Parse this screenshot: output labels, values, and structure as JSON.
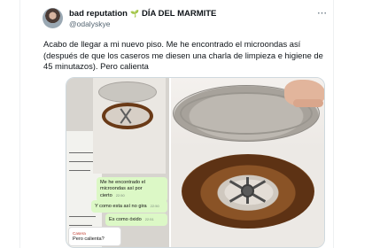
{
  "tweet": {
    "display_name": "bad reputation",
    "name_suffix": "DÍA DEL MARMITE",
    "handle": "@odalyskye",
    "text": "Acabo de llegar a mi nuevo piso. Me he encontrado el microondas así (después de que los caseros me diesen una charla de limpieza e higiene de 45 minutazos). Pero calienta"
  },
  "chat": {
    "messages": [
      {
        "text": "Me he encontrado el microondas así por cierto",
        "time": "22:50"
      },
      {
        "text": "Y como esta así no gira",
        "time": "22:50"
      },
      {
        "text": "Es como óxido",
        "time": "22:51"
      }
    ],
    "reply": {
      "sender": "Casera",
      "text": "Pero calienta?"
    }
  },
  "icons": {
    "leaf": "plant-leaf-icon",
    "more": "more-options-icon"
  },
  "colors": {
    "text_primary": "#0f1419",
    "text_secondary": "#536471",
    "chat_out": "#dcf8c6",
    "leaf": "#2e8b57"
  }
}
